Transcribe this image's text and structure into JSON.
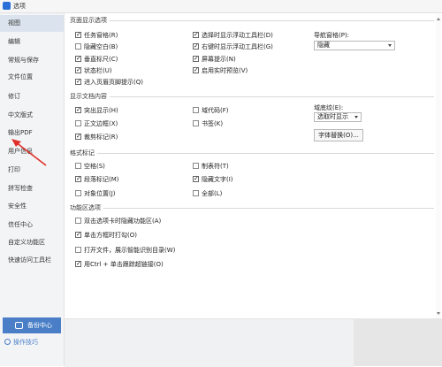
{
  "window": {
    "title": "选项"
  },
  "sidebar": {
    "items": [
      {
        "label": "视图"
      },
      {
        "label": "编辑"
      },
      {
        "label": "常规与保存"
      },
      {
        "label": "文件位置"
      },
      {
        "label": "修订"
      },
      {
        "label": "中文版式"
      },
      {
        "label": "输出PDF"
      },
      {
        "label": "用户信息"
      },
      {
        "label": "打印"
      },
      {
        "label": "拼写检查"
      },
      {
        "label": "安全性"
      },
      {
        "label": "信任中心"
      },
      {
        "label": "自定义功能区"
      },
      {
        "label": "快速访问工具栏"
      }
    ],
    "active_index": 0,
    "backup_label": "备份中心",
    "tips_label": "操作技巧"
  },
  "sections": {
    "page_display": {
      "title": "页面显示选项",
      "col1": [
        {
          "label": "任务窗格(R)",
          "checked": true
        },
        {
          "label": "隐藏空白(B)",
          "checked": false
        },
        {
          "label": "垂直标尺(C)",
          "checked": true
        },
        {
          "label": "状态栏(U)",
          "checked": true
        },
        {
          "label": "进入页眉页脚提示(Q)",
          "checked": true
        }
      ],
      "col2": [
        {
          "label": "选择时显示浮动工具栏(D)",
          "checked": true
        },
        {
          "label": "右键时显示浮动工具栏(G)",
          "checked": true
        },
        {
          "label": "屏幕提示(N)",
          "checked": true
        },
        {
          "label": "启用实时预览(V)",
          "checked": true
        }
      ],
      "nav_label": "导航窗格(P):",
      "nav_value": "隐藏"
    },
    "show_content": {
      "title": "显示文档内容",
      "col1": [
        {
          "label": "突出显示(H)",
          "checked": true
        },
        {
          "label": "正文边框(X)",
          "checked": false
        },
        {
          "label": "裁剪标记(R)",
          "checked": true
        }
      ],
      "col2": [
        {
          "label": "域代码(F)",
          "checked": false
        },
        {
          "label": "书签(K)",
          "checked": false
        }
      ],
      "shading_label": "域底纹(E):",
      "shading_value": "选取时显示",
      "font_button": "字体替换(O)..."
    },
    "format_marks": {
      "title": "格式标记",
      "col1": [
        {
          "label": "空格(S)",
          "checked": false
        },
        {
          "label": "段落标记(M)",
          "checked": true
        },
        {
          "label": "对象位置(J)",
          "checked": false
        }
      ],
      "col2": [
        {
          "label": "制表符(T)",
          "checked": false
        },
        {
          "label": "隐藏文字(I)",
          "checked": true
        },
        {
          "label": "全部(L)",
          "checked": false
        }
      ]
    },
    "ribbon": {
      "title": "功能区选项",
      "col1": [
        {
          "label": "双击选项卡时隐藏功能区(A)",
          "checked": false
        },
        {
          "label": "单击方框时打勾(O)",
          "checked": true
        },
        {
          "label": "打开文件，展示智能识别目录(W)",
          "checked": false
        },
        {
          "label": "用Ctrl + 单击跟踪超链接(O)",
          "checked": true
        }
      ]
    }
  },
  "colors": {
    "accent": "#4a7fc7",
    "annotation_arrow": "#e0302a"
  }
}
